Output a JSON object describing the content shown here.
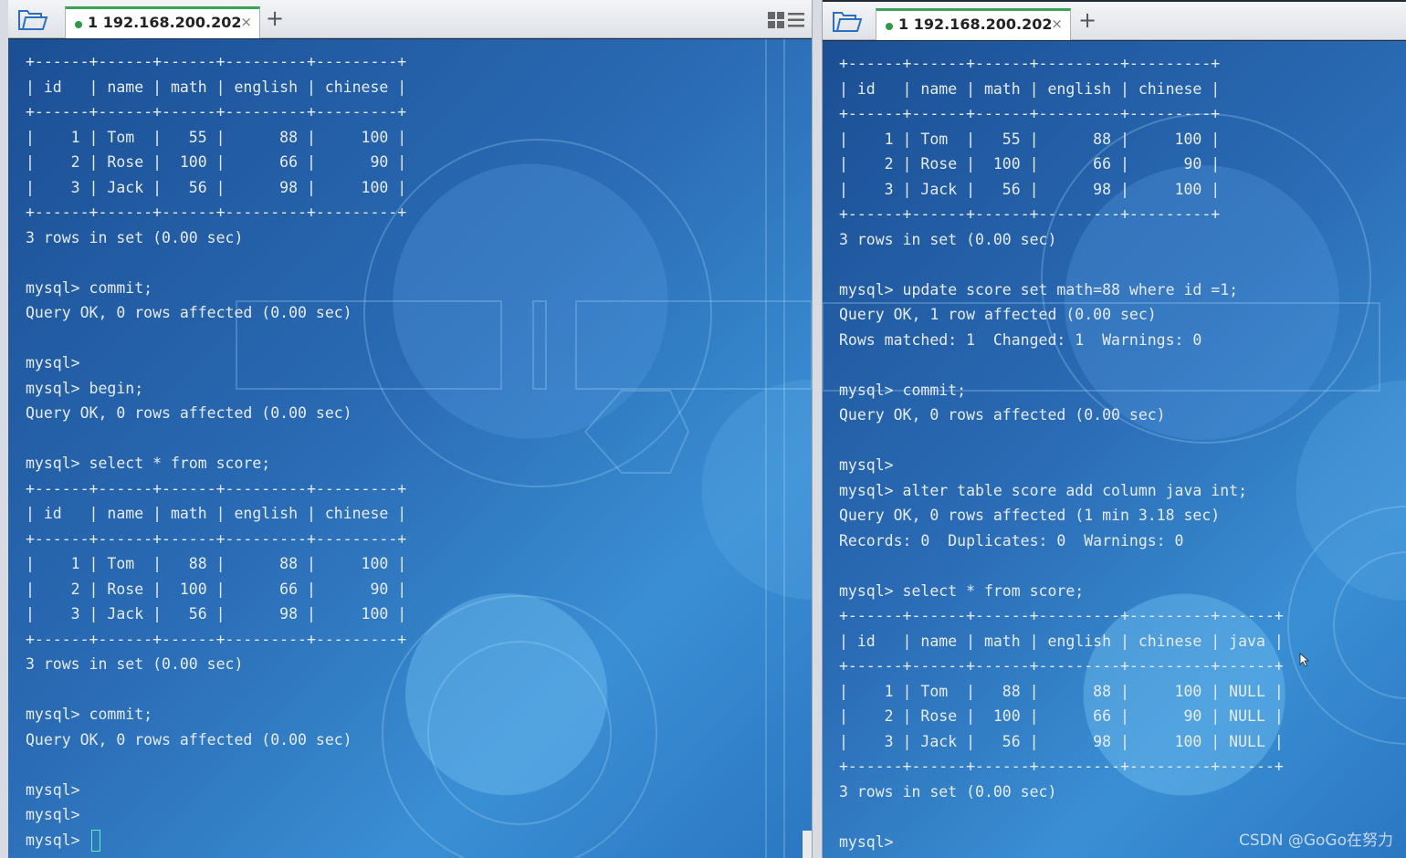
{
  "left": {
    "tab": {
      "title": "1 192.168.200.202",
      "close": "×",
      "add": "+"
    },
    "lines": [
      "+------+------+------+---------+---------+",
      "| id   | name | math | english | chinese |",
      "+------+------+------+---------+---------+",
      "|    1 | Tom  |   55 |      88 |     100 |",
      "|    2 | Rose |  100 |      66 |      90 |",
      "|    3 | Jack |   56 |      98 |     100 |",
      "+------+------+------+---------+---------+",
      "3 rows in set (0.00 sec)",
      "",
      "mysql> commit;",
      "Query OK, 0 rows affected (0.00 sec)",
      "",
      "mysql>",
      "mysql> begin;",
      "Query OK, 0 rows affected (0.00 sec)",
      "",
      "mysql> select * from score;",
      "+------+------+------+---------+---------+",
      "| id   | name | math | english | chinese |",
      "+------+------+------+---------+---------+",
      "|    1 | Tom  |   88 |      88 |     100 |",
      "|    2 | Rose |  100 |      66 |      90 |",
      "|    3 | Jack |   56 |      98 |     100 |",
      "+------+------+------+---------+---------+",
      "3 rows in set (0.00 sec)",
      "",
      "mysql> commit;",
      "Query OK, 0 rows affected (0.00 sec)",
      "",
      "mysql>",
      "mysql>",
      "mysql> "
    ]
  },
  "right": {
    "tab": {
      "title": "1 192.168.200.202",
      "close": "×",
      "add": "+"
    },
    "lines": [
      "+------+------+------+---------+---------+",
      "| id   | name | math | english | chinese |",
      "+------+------+------+---------+---------+",
      "|    1 | Tom  |   55 |      88 |     100 |",
      "|    2 | Rose |  100 |      66 |      90 |",
      "|    3 | Jack |   56 |      98 |     100 |",
      "+------+------+------+---------+---------+",
      "3 rows in set (0.00 sec)",
      "",
      "mysql> update score set math=88 where id =1;",
      "Query OK, 1 row affected (0.00 sec)",
      "Rows matched: 1  Changed: 1  Warnings: 0",
      "",
      "mysql> commit;",
      "Query OK, 0 rows affected (0.00 sec)",
      "",
      "mysql>",
      "mysql> alter table score add column java int;",
      "Query OK, 0 rows affected (1 min 3.18 sec)",
      "Records: 0  Duplicates: 0  Warnings: 0",
      "",
      "mysql> select * from score;",
      "+------+------+------+---------+---------+------+",
      "| id   | name | math | english | chinese | java |",
      "+------+------+------+---------+---------+------+",
      "|    1 | Tom  |   88 |      88 |     100 | NULL |",
      "|    2 | Rose |  100 |      66 |      90 | NULL |",
      "|    3 | Jack |   56 |      98 |     100 | NULL |",
      "+------+------+------+---------+---------+------+",
      "3 rows in set (0.00 sec)",
      "",
      "mysql>"
    ]
  },
  "watermark": "CSDN @GoGo在努力",
  "icons": {
    "open_folder": "folder-open-icon",
    "connected_status": "status-dot-icon",
    "layout": "grid-layout-icon",
    "menu": "hamburger-menu-icon"
  },
  "colors": {
    "terminal_text": "#e6ecf5",
    "cursor": "#5ef0c0",
    "connected": "#2e9a45"
  }
}
